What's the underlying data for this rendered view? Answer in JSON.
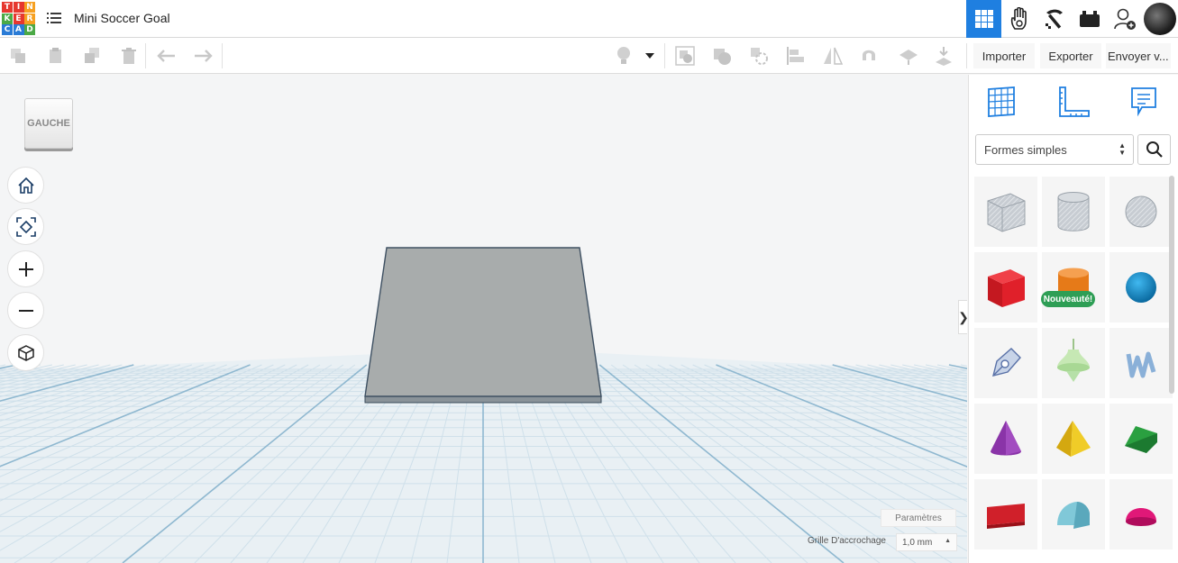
{
  "app": {
    "logo_letters": [
      "T",
      "I",
      "N",
      "K",
      "E",
      "R",
      "C",
      "A",
      "D"
    ],
    "logo_colors": [
      "#e6372f",
      "#e6372f",
      "#f6a021",
      "#4ba946",
      "#e6372f",
      "#f6a021",
      "#2a7bd6",
      "#2a7bd6",
      "#4ba946"
    ],
    "project_title": "Mini Soccer Goal"
  },
  "toolbar": {
    "import_label": "Importer",
    "export_label": "Exporter",
    "send_label": "Envoyer v..."
  },
  "workspace": {
    "view_label": "GAUCHE",
    "settings_label": "Paramètres",
    "grid_label": "Grille D'accrochage",
    "grid_value": "1,0 mm"
  },
  "panel": {
    "category": "Formes simples",
    "new_badge": "Nouveauté!",
    "shapes": [
      {
        "name": "box-hole",
        "color": "#b8bfc8"
      },
      {
        "name": "cylinder-hole",
        "color": "#b8bfc8"
      },
      {
        "name": "sphere-hole",
        "color": "#b8bfc8"
      },
      {
        "name": "box",
        "color": "#e0202a"
      },
      {
        "name": "cylinder",
        "color": "#f08020"
      },
      {
        "name": "sphere",
        "color": "#1c8fd0"
      },
      {
        "name": "scribble",
        "color": "#7090c0"
      },
      {
        "name": "spinner",
        "color": "#b6e0a8"
      },
      {
        "name": "shape-generator",
        "color": "#90b8e0"
      },
      {
        "name": "cone",
        "color": "#8a34a8"
      },
      {
        "name": "pyramid",
        "color": "#e8c21a"
      },
      {
        "name": "roof",
        "color": "#2aa040"
      },
      {
        "name": "text",
        "color": "#d0202a"
      },
      {
        "name": "half-cylinder",
        "color": "#80c8d8"
      },
      {
        "name": "paraboloid",
        "color": "#e01878"
      }
    ]
  }
}
